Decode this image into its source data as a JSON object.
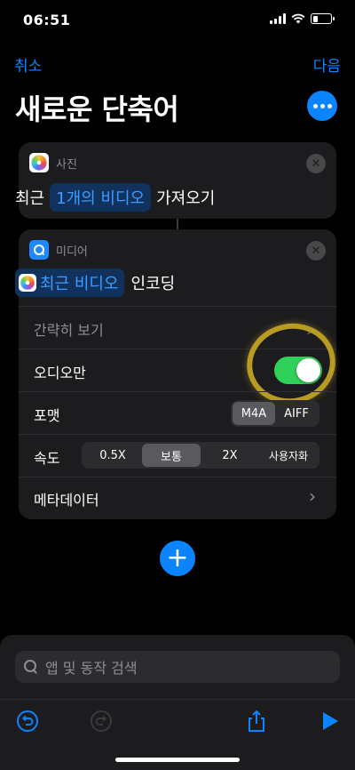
{
  "status": {
    "time": "06:51"
  },
  "nav": {
    "cancel": "취소",
    "next": "다음",
    "title": "새로운 단축어"
  },
  "card_photos": {
    "app_label": "사진",
    "prefix": "최근",
    "param": "1개의 비디오",
    "suffix": "가져오기"
  },
  "card_media": {
    "app_label": "미디어",
    "param": "최근 비디오",
    "suffix": "인코딩",
    "simplify_label": "간략히 보기",
    "audio_only_label": "오디오만",
    "audio_only_on": true,
    "format_label": "포맷",
    "format_options": [
      "M4A",
      "AIFF"
    ],
    "format_selected": "M4A",
    "speed_label": "속도",
    "speed_options": [
      "0.5X",
      "보통",
      "2X",
      "사용자화"
    ],
    "speed_selected": "보통",
    "metadata_label": "메타데이터"
  },
  "search": {
    "placeholder": "앱 및 동작 검색"
  },
  "colors": {
    "accent": "#0a84ff",
    "toggle_on": "#30d158",
    "highlight_ring": "#b89b23"
  }
}
